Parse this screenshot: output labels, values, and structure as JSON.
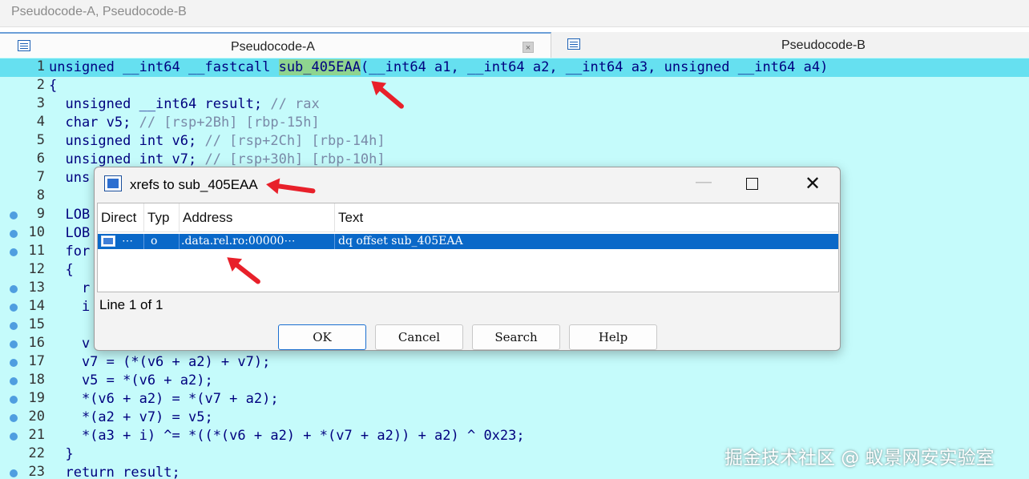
{
  "window": {
    "title": "Pseudocode-A, Pseudocode-B"
  },
  "tabs": [
    {
      "label": "Pseudocode-A",
      "icon": "pseudocode-icon",
      "close_glyph": "×"
    },
    {
      "label": "Pseudocode-B",
      "icon": "pseudocode-icon"
    }
  ],
  "code": {
    "lines": [
      {
        "num": "1",
        "bp": false,
        "hl": true
      },
      {
        "num": "2",
        "bp": false
      },
      {
        "num": "3",
        "bp": false
      },
      {
        "num": "4",
        "bp": false
      },
      {
        "num": "5",
        "bp": false
      },
      {
        "num": "6",
        "bp": false
      },
      {
        "num": "7",
        "bp": false
      },
      {
        "num": "8",
        "bp": false
      },
      {
        "num": "9",
        "bp": true
      },
      {
        "num": "10",
        "bp": true
      },
      {
        "num": "11",
        "bp": true
      },
      {
        "num": "12",
        "bp": false
      },
      {
        "num": "13",
        "bp": true
      },
      {
        "num": "14",
        "bp": true
      },
      {
        "num": "15",
        "bp": true
      },
      {
        "num": "16",
        "bp": true
      },
      {
        "num": "17",
        "bp": true
      },
      {
        "num": "18",
        "bp": true
      },
      {
        "num": "19",
        "bp": true
      },
      {
        "num": "20",
        "bp": true
      },
      {
        "num": "21",
        "bp": true
      },
      {
        "num": "22",
        "bp": false
      },
      {
        "num": "23",
        "bp": true
      }
    ],
    "text": {
      "l1a": "unsigned __int64 __fastcall ",
      "l1fn": "sub_405EAA",
      "l1b": "(__int64 a1, __int64 a2, __int64 a3, unsigned __int64 a4)",
      "l2": "{",
      "l3": "  unsigned __int64 result; ",
      "l3c": "// rax",
      "l4": "  char v5; ",
      "l4c": "// [rsp+2Bh] [rbp-15h]",
      "l5": "  unsigned int v6; ",
      "l5c": "// [rsp+2Ch] [rbp-14h]",
      "l6": "  unsigned int v7; ",
      "l6c": "// [rsp+30h] [rbp-10h]",
      "l7": "  uns",
      "l9": "  LOB",
      "l10": "  LOB",
      "l11": "  for",
      "l12": "  {",
      "l13": "    r",
      "l14": "    i",
      "l16": "    v",
      "l17": "    v7 = (*(v6 + a2) + v7);",
      "l18": "    v5 = *(v6 + a2);",
      "l19": "    *(v6 + a2) = *(v7 + a2);",
      "l20": "    *(a2 + v7) = v5;",
      "l21": "    *(a3 + i) ^= *((*(v6 + a2) + *(v7 + a2)) + a2) ^ 0x23;",
      "l22": "  }",
      "l23": "  return result;"
    }
  },
  "dialog": {
    "title": "xrefs to sub_405EAA",
    "minimize_glyph": "—",
    "close_glyph": "✕",
    "columns": {
      "direct": "Direct",
      "type": "Typ",
      "address": "Address",
      "text": "Text"
    },
    "row": {
      "direct": "⋯",
      "type": "o",
      "address": ".data.rel.ro:00000⋯",
      "text": "dq offset sub_405EAA"
    },
    "status": "Line 1 of 1",
    "buttons": {
      "ok": "OK",
      "cancel": "Cancel",
      "search": "Search",
      "help": "Help"
    }
  },
  "watermark": "掘金技术社区 @ 蚁景网安实验室",
  "colors": {
    "code_bg": "#c5fbfb",
    "highlight_line": "#66e0f0",
    "function_highlight": "#8fd48f",
    "selection": "#0a68c8",
    "arrow": "#e8202a"
  }
}
